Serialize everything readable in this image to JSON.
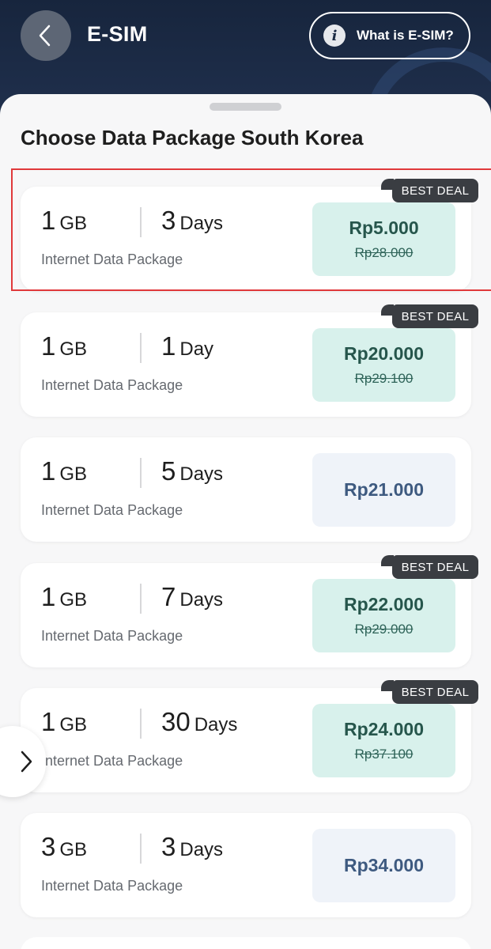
{
  "header": {
    "title": "E-SIM",
    "info_label": "What is E-SIM?",
    "info_icon": "info-icon",
    "back_icon": "chevron-left-icon"
  },
  "sheet": {
    "title": "Choose Data Package South Korea"
  },
  "packages": [
    {
      "data": "1",
      "data_unit": "GB",
      "duration": "3",
      "duration_unit": "Days",
      "desc": "Internet Data Package",
      "price": "Rp5.000",
      "old_price": "Rp28.000",
      "badge": "BEST DEAL"
    },
    {
      "data": "1",
      "data_unit": "GB",
      "duration": "1",
      "duration_unit": "Day",
      "desc": "Internet Data Package",
      "price": "Rp20.000",
      "old_price": "Rp29.100",
      "badge": "BEST DEAL"
    },
    {
      "data": "1",
      "data_unit": "GB",
      "duration": "5",
      "duration_unit": "Days",
      "desc": "Internet Data Package",
      "price": "Rp21.000"
    },
    {
      "data": "1",
      "data_unit": "GB",
      "duration": "7",
      "duration_unit": "Days",
      "desc": "Internet Data Package",
      "price": "Rp22.000",
      "old_price": "Rp29.000",
      "badge": "BEST DEAL"
    },
    {
      "data": "1",
      "data_unit": "GB",
      "duration": "30",
      "duration_unit": "Days",
      "desc": "Internet Data Package",
      "price": "Rp24.000",
      "old_price": "Rp37.100",
      "badge": "BEST DEAL"
    },
    {
      "data": "3",
      "data_unit": "GB",
      "duration": "3",
      "duration_unit": "Days",
      "desc": "Internet Data Package",
      "price": "Rp34.000"
    }
  ],
  "colors": {
    "header_bg": "#1b2a44",
    "deal_price_bg": "#d8f1ec",
    "plain_price_bg": "#eff3f9",
    "badge_bg": "#3a3d42",
    "highlight_border": "#e0393b"
  }
}
